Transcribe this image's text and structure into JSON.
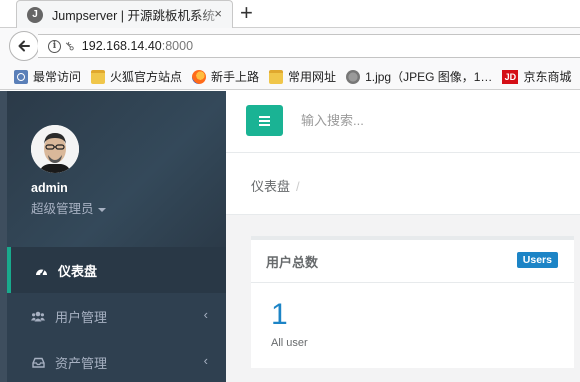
{
  "browser": {
    "tab_favicon": "J",
    "tab_title": "Jumpserver | 开源跳板机系统",
    "tab_close": "×",
    "new_tab": "+",
    "url_host": "192.168.14.40",
    "url_port": ":8000"
  },
  "bookmarks": [
    {
      "icon": "most-visited-icon",
      "label": "最常访问"
    },
    {
      "icon": "folder-icon",
      "label": "火狐官方站点"
    },
    {
      "icon": "firefox-icon",
      "label": "新手上路"
    },
    {
      "icon": "folder-icon",
      "label": "常用网址"
    },
    {
      "icon": "globe-icon",
      "label": "1.jpg（JPEG 图像，1…"
    },
    {
      "icon": "jd-icon",
      "label": "京东商城"
    }
  ],
  "jd_badge": "JD",
  "sidebar": {
    "user_name": "admin",
    "user_role": "超级管理员",
    "items": [
      {
        "label": "仪表盘",
        "icon": "dashboard-icon",
        "active": true
      },
      {
        "label": "用户管理",
        "icon": "users-icon",
        "arrow": "‹"
      },
      {
        "label": "资产管理",
        "icon": "assets-icon",
        "arrow": "‹"
      }
    ]
  },
  "topbar": {
    "search_placeholder": "输入搜索..."
  },
  "heading": {
    "breadcrumb": "仪表盘",
    "separator": "/"
  },
  "widget": {
    "title": "用户总数",
    "badge": "Users",
    "count": "1",
    "subtitle": "All user"
  },
  "colors": {
    "accent": "#1ab394",
    "sidebar": "#2f4050",
    "badge": "#1c84c6"
  }
}
